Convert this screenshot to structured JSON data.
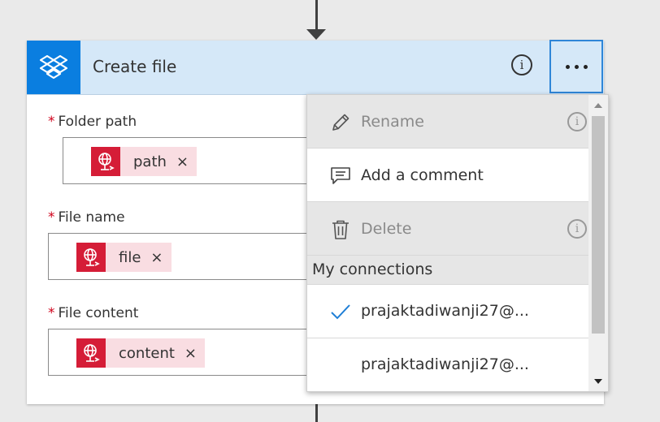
{
  "action": {
    "title": "Create file",
    "app_icon": "dropbox-icon",
    "brand_color": "#0a7ee0",
    "header_color": "#d5e8f8",
    "info_glyph": "i",
    "more_icon": "ellipsis-icon"
  },
  "fields": [
    {
      "label": "Folder path",
      "required_mark": "*",
      "token": "path",
      "remove": "×"
    },
    {
      "label": "File name",
      "required_mark": "*",
      "token": "file",
      "remove": "×"
    },
    {
      "label": "File content",
      "required_mark": "*",
      "token": "content",
      "remove": "×"
    }
  ],
  "token_icon": "globe-network-icon",
  "token_color": "#d51d37",
  "menu": {
    "items": [
      {
        "label": "Rename",
        "icon": "pencil-icon",
        "enabled": false,
        "info": "i"
      },
      {
        "label": "Add a comment",
        "icon": "comment-icon",
        "enabled": true
      },
      {
        "label": "Delete",
        "icon": "trash-icon",
        "enabled": false,
        "info": "i"
      }
    ],
    "connections_header": "My connections",
    "connections": [
      {
        "label": "prajaktadiwanji27@...",
        "selected": true
      },
      {
        "label": "prajaktadiwanji27@...",
        "selected": false
      }
    ]
  }
}
